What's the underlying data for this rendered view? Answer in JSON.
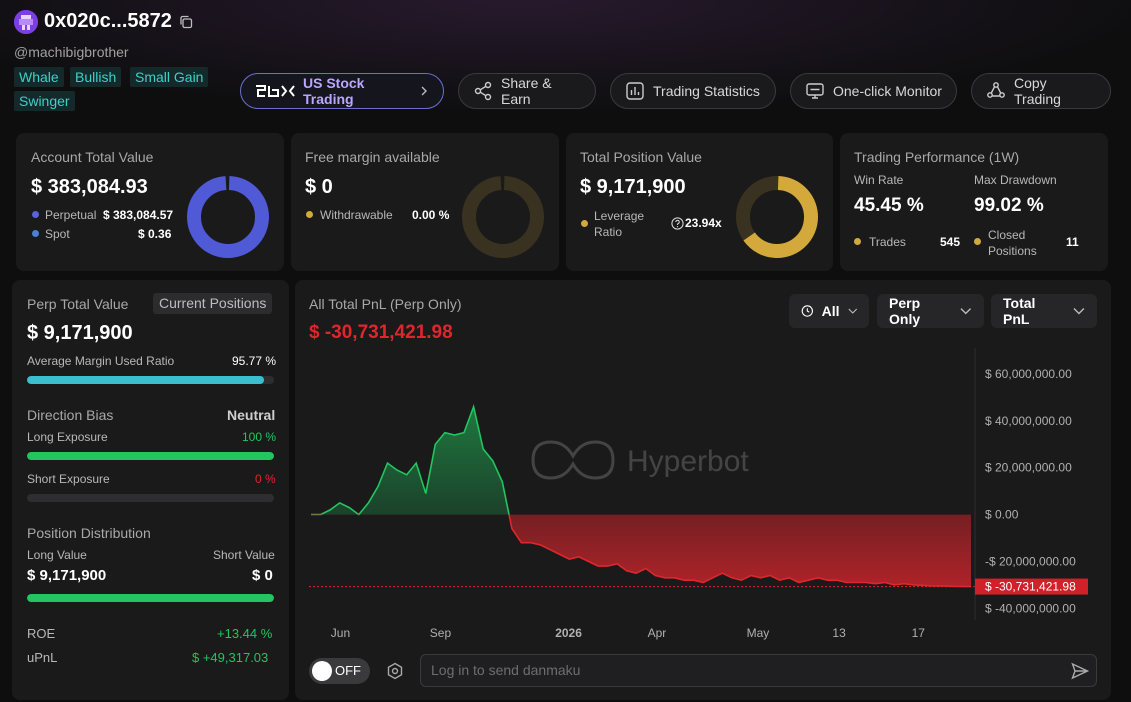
{
  "header": {
    "title": "0x020c...5872",
    "handle": "@machibigbrother",
    "tags": [
      "Whale",
      "Bullish",
      "Small Gain",
      "Swinger"
    ]
  },
  "top_buttons": {
    "us_stock": "US Stock Trading",
    "share": "Share & Earn",
    "stats": "Trading Statistics",
    "monitor": "One-click Monitor",
    "copy": "Copy Trading"
  },
  "account": {
    "label": "Account Total Value",
    "value": "$ 383,084.93",
    "perp_label": "Perpetual",
    "perp_value": "$ 383,084.57",
    "spot_label": "Spot",
    "spot_value": "$ 0.36"
  },
  "margin": {
    "label": "Free margin available",
    "value": "$ 0",
    "withdraw_label": "Withdrawable",
    "withdraw_value": "0.00 %"
  },
  "position": {
    "label": "Total Position Value",
    "value": "$ 9,171,900",
    "leverage_label": "Leverage Ratio",
    "leverage_value": "23.94x"
  },
  "performance": {
    "label": "Trading Performance (1W)",
    "win_rate_label": "Win Rate",
    "win_rate": "45.45 %",
    "drawdown_label": "Max Drawdown",
    "drawdown": "99.02 %",
    "trades_label": "Trades",
    "trades": "545",
    "closed_label": "Closed Positions",
    "closed": "11"
  },
  "left_panel": {
    "perp_label": "Perp Total Value",
    "current_positions": "Current Positions",
    "perp_value": "$ 9,171,900",
    "margin_ratio_label": "Average Margin Used Ratio",
    "margin_ratio": "95.77 %",
    "margin_ratio_fill": 0.9577,
    "bias_label": "Direction Bias",
    "bias_value": "Neutral",
    "long_exp_label": "Long Exposure",
    "long_exp": "100 %",
    "long_exp_fill": 1.0,
    "short_exp_label": "Short Exposure",
    "short_exp": "0 %",
    "short_exp_fill": 0,
    "dist_label": "Position Distribution",
    "long_value_label": "Long Value",
    "short_value_label": "Short Value",
    "long_value": "$ 9,171,900",
    "short_value": "$ 0",
    "dist_fill": 1.0,
    "roe_label": "ROE",
    "roe": "+13.44 %",
    "upnl_label": "uPnL",
    "upnl": "$ +49,317.03"
  },
  "pnl": {
    "label": "All Total PnL (Perp Only)",
    "value": "$ -30,731,421.98",
    "filter_time": "All",
    "filter_type": "Perp Only",
    "filter_metric": "Total PnL",
    "watermark": "Hyperbot",
    "danmaku_placeholder": "Log in to send danmaku",
    "toggle": "OFF"
  },
  "chart_data": {
    "type": "area",
    "title": "All Total PnL (Perp Only)",
    "x_tick_labels": [
      "Jun",
      "Sep",
      "2026",
      "Apr",
      "May",
      "13",
      "17"
    ],
    "y_tick_labels": [
      "$ 60,000,000.00",
      "$ 40,000,000.00",
      "$ 20,000,000.00",
      "$ 0.00",
      "-$ 20,000,000.00",
      "$ -40,000,000.00"
    ],
    "y_ticks": [
      60000000,
      40000000,
      20000000,
      0,
      -20000000,
      -40000000
    ],
    "ylim": [
      -45000000,
      66000000
    ],
    "current_value_label": "$ -30,731,421.98",
    "current_value": -30731421.98,
    "colors": {
      "positive": "#22c55e",
      "negative": "#e0262d"
    },
    "series": [
      {
        "values": [
          0,
          0,
          2000000,
          5000000,
          3000000,
          0,
          5000000,
          12000000,
          22000000,
          19000000,
          17000000,
          22000000,
          9000000,
          30000000,
          35000000,
          34000000,
          35000000,
          46000000,
          28000000,
          23000000,
          14000000,
          -6000000,
          -12000000,
          -12000000,
          -13000000,
          -15000000,
          -17000000,
          -19000000,
          -18000000,
          -20000000,
          -22000000,
          -22000000,
          -21000000,
          -24000000,
          -25000000,
          -23000000,
          -26000000,
          -27000000,
          -27000000,
          -28000000,
          -28000000,
          -29000000,
          -27000000,
          -25000000,
          -27000000,
          -28000000,
          -26000000,
          -27000000,
          -26000000,
          -28000000,
          -27000000,
          -29000000,
          -28000000,
          -27000000,
          -28000000,
          -28000000,
          -29000000,
          -29000000,
          -29000000,
          -29500000,
          -29000000,
          -30000000,
          -29500000,
          -30000000,
          -30200000,
          -30500000,
          -30400000,
          -30600000,
          -30700000,
          -30731422
        ]
      }
    ]
  }
}
